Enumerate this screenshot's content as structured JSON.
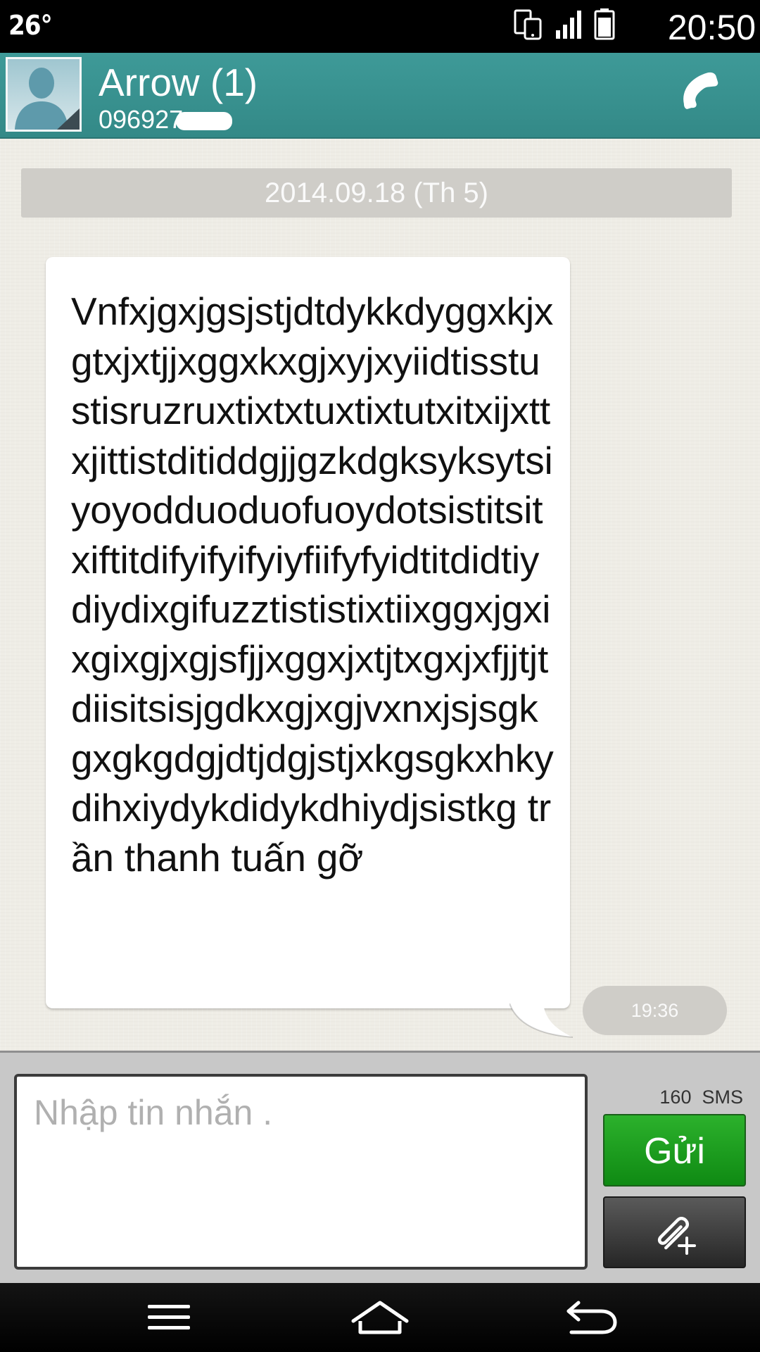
{
  "status_bar": {
    "temperature": "26°",
    "time": "20:50",
    "icons": [
      "dual-device-icon",
      "signal-icon",
      "battery-icon"
    ]
  },
  "header": {
    "contact_name": "Arrow (1)",
    "contact_number": "096927",
    "contact_number_redacted": true,
    "call_icon": "phone-icon"
  },
  "conversation": {
    "date_separator": "2014.09.18 (Th 5)",
    "messages": [
      {
        "direction": "incoming",
        "text": "Vnfxjgxjgsjstjdtdykkdyggxkjxgtxjxtjjxggxkxgjxyjxyiidtisstustisruzruxtixtxtuxtixtutxitxijxttxjittistditiddgjjgzkdgksyksytsiyoyodduoduofuoydotsistitsitxiftitdifyifyifyiyfiifyfyidtitdidtiydiydixgifuzztististixtiixggxjgxixgixgjxgjsfjjxggxjxtjtxgxjxfjjtjtdiisitsisjgdkxgjxgjvxnxjsjsgkgxgkgdgjdtjdgjstjxkgsgkxhkydihxiydykdidykdhiydjsistkg trần thanh tuấn gỡ",
        "time": "19:36"
      }
    ]
  },
  "composer": {
    "placeholder": "Nhập tin nhắn .",
    "value": "",
    "char_count": "160",
    "message_type": "SMS",
    "send_label": "Gửi",
    "attach_icon": "paperclip-plus-icon"
  },
  "nav_bar": {
    "items": [
      "menu-icon",
      "home-icon",
      "back-icon"
    ]
  },
  "colors": {
    "header": "#3e9a98",
    "conversation_bg": "#efede6",
    "send_button": "#1c9c1f",
    "timestamp_bg": "#cfcdc8"
  }
}
